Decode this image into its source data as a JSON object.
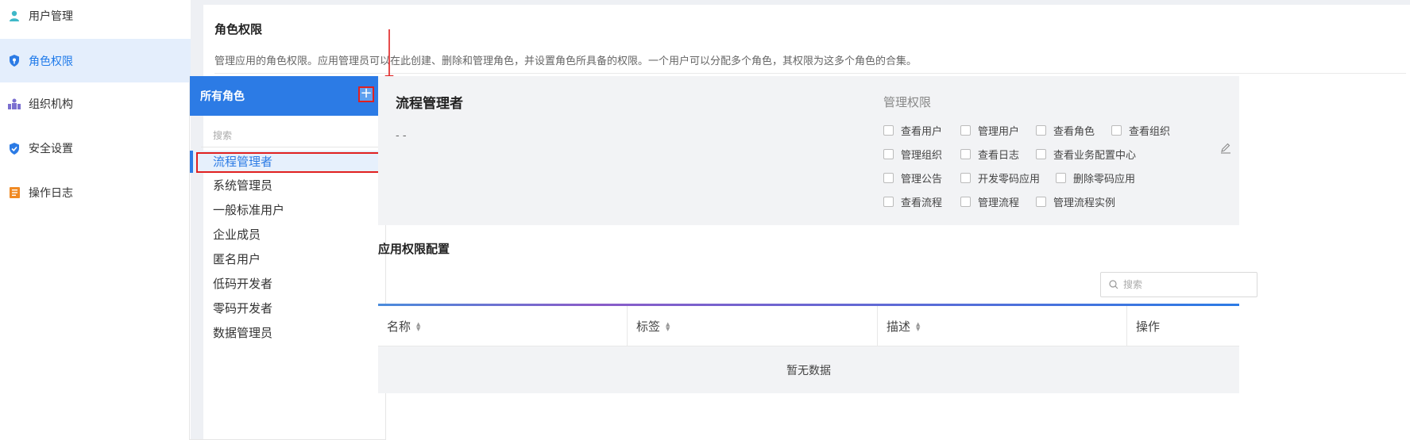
{
  "sidebar": {
    "items": [
      {
        "label": "用户管理",
        "icon": "user-icon"
      },
      {
        "label": "角色权限",
        "icon": "shield-key-icon"
      },
      {
        "label": "组织机构",
        "icon": "org-icon"
      },
      {
        "label": "安全设置",
        "icon": "shield-check-icon"
      },
      {
        "label": "操作日志",
        "icon": "log-icon"
      }
    ],
    "active": "角色权限"
  },
  "page": {
    "title": "角色权限",
    "description": "管理应用的角色权限。应用管理员可以在此创建、删除和管理角色，并设置角色所具备的权限。一个用户可以分配多个角色，其权限为这多个角色的合集。"
  },
  "roles": {
    "header": "所有角色",
    "add_button": "+",
    "search_placeholder": "搜索",
    "items": [
      "流程管理者",
      "系统管理员",
      "一般标准用户",
      "企业成员",
      "匿名用户",
      "低码开发者",
      "零码开发者",
      "数据管理员"
    ],
    "selected": "流程管理者"
  },
  "permissions": {
    "role_name": "流程管理者",
    "role_desc": "- -",
    "title": "管理权限",
    "rows": [
      [
        "查看用户",
        "管理用户",
        "查看角色",
        "查看组织"
      ],
      [
        "管理组织",
        "查看日志",
        "查看业务配置中心"
      ],
      [
        "管理公告",
        "开发零码应用",
        "删除零码应用"
      ],
      [
        "查看流程",
        "管理流程",
        "管理流程实例"
      ]
    ]
  },
  "app_config": {
    "title": "应用权限配置",
    "search_placeholder": "搜索",
    "columns": [
      "名称",
      "标签",
      "描述",
      "操作"
    ],
    "empty_text": "暂无数据"
  },
  "colors": {
    "accent": "#2c7be5",
    "highlight_red": "#e02020",
    "panel_bg": "#f2f3f5"
  }
}
